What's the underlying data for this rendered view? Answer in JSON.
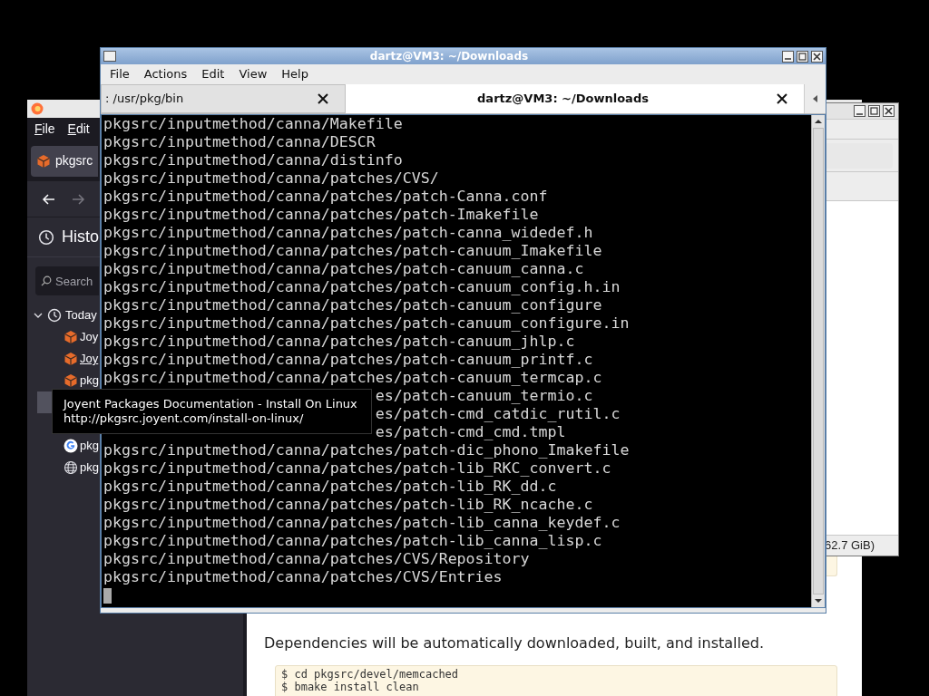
{
  "browser": {
    "menu": [
      "File",
      "Edit"
    ],
    "tab": {
      "label": "pkgsrc"
    },
    "sidebar": {
      "title": "Histo",
      "search": {
        "placeholder": "Search"
      },
      "tree": [
        {
          "label": "Today",
          "expanded": true,
          "children": [
            {
              "kind": "package",
              "label": "Joy",
              "underlined": false
            },
            {
              "kind": "package",
              "label": "Joy",
              "underlined": true
            },
            {
              "kind": "package",
              "label": "pkg",
              "underlined": false
            },
            {
              "kind": "covered",
              "highlighted": true
            },
            {
              "kind": "covered"
            },
            {
              "kind": "search",
              "label": "pkg",
              "underlined": false
            },
            {
              "kind": "web",
              "label": "pkg",
              "underlined": false
            }
          ]
        }
      ]
    },
    "page": {
      "paragraph": "Dependencies will be automatically downloaded, built, and installed.",
      "code": [
        "$ cd pkgsrc/devel/memcached",
        "$ bmake install clean"
      ]
    }
  },
  "file_manager": {
    "status": "62.7 GiB)"
  },
  "tooltip": {
    "title": "Joyent Packages Documentation - Install On Linux",
    "url": "http://pkgsrc.joyent.com/install-on-linux/"
  },
  "terminal": {
    "title": "dartz@VM3: ~/Downloads",
    "menu": [
      "File",
      "Actions",
      "Edit",
      "View",
      "Help"
    ],
    "tabs": [
      {
        "label": ": /usr/pkg/bin",
        "selected": false
      },
      {
        "label": "dartz@VM3: ~/Downloads",
        "selected": true
      }
    ],
    "lines": [
      {
        "kind": "full",
        "text": "pkgsrc/inputmethod/canna/Makefile"
      },
      {
        "kind": "full",
        "text": "pkgsrc/inputmethod/canna/DESCR"
      },
      {
        "kind": "full",
        "text": "pkgsrc/inputmethod/canna/distinfo"
      },
      {
        "kind": "full",
        "text": "pkgsrc/inputmethod/canna/patches/CVS/"
      },
      {
        "kind": "full",
        "text": "pkgsrc/inputmethod/canna/patches/patch-Canna.conf"
      },
      {
        "kind": "full",
        "text": "pkgsrc/inputmethod/canna/patches/patch-Imakefile"
      },
      {
        "kind": "full",
        "text": "pkgsrc/inputmethod/canna/patches/patch-canna_widedef.h"
      },
      {
        "kind": "full",
        "text": "pkgsrc/inputmethod/canna/patches/patch-canuum_Imakefile"
      },
      {
        "kind": "full",
        "text": "pkgsrc/inputmethod/canna/patches/patch-canuum_canna.c"
      },
      {
        "kind": "full",
        "text": "pkgsrc/inputmethod/canna/patches/patch-canuum_config.h.in"
      },
      {
        "kind": "full",
        "text": "pkgsrc/inputmethod/canna/patches/patch-canuum_configure"
      },
      {
        "kind": "full",
        "text": "pkgsrc/inputmethod/canna/patches/patch-canuum_configure.in"
      },
      {
        "kind": "full",
        "text": "pkgsrc/inputmethod/canna/patches/patch-canuum_jhlp.c"
      },
      {
        "kind": "full",
        "text": "pkgsrc/inputmethod/canna/patches/patch-canuum_printf.c"
      },
      {
        "kind": "full",
        "text": "pkgsrc/inputmethod/canna/patches/patch-canuum_termcap.c"
      },
      {
        "kind": "covered",
        "text": "es/patch-canuum_termio.c"
      },
      {
        "kind": "covered",
        "text": "es/patch-cmd_catdic_rutil.c"
      },
      {
        "kind": "covered",
        "text": "es/patch-cmd_cmd.tmpl"
      },
      {
        "kind": "full",
        "text": "pkgsrc/inputmethod/canna/patches/patch-dic_phono_Imakefile"
      },
      {
        "kind": "full",
        "text": "pkgsrc/inputmethod/canna/patches/patch-lib_RKC_convert.c"
      },
      {
        "kind": "full",
        "text": "pkgsrc/inputmethod/canna/patches/patch-lib_RK_dd.c"
      },
      {
        "kind": "full",
        "text": "pkgsrc/inputmethod/canna/patches/patch-lib_RK_ncache.c"
      },
      {
        "kind": "full",
        "text": "pkgsrc/inputmethod/canna/patches/patch-lib_canna_keydef.c"
      },
      {
        "kind": "full",
        "text": "pkgsrc/inputmethod/canna/patches/patch-lib_canna_lisp.c"
      },
      {
        "kind": "full",
        "text": "pkgsrc/inputmethod/canna/patches/CVS/Repository"
      },
      {
        "kind": "full",
        "text": "pkgsrc/inputmethod/canna/patches/CVS/Entries"
      }
    ]
  }
}
